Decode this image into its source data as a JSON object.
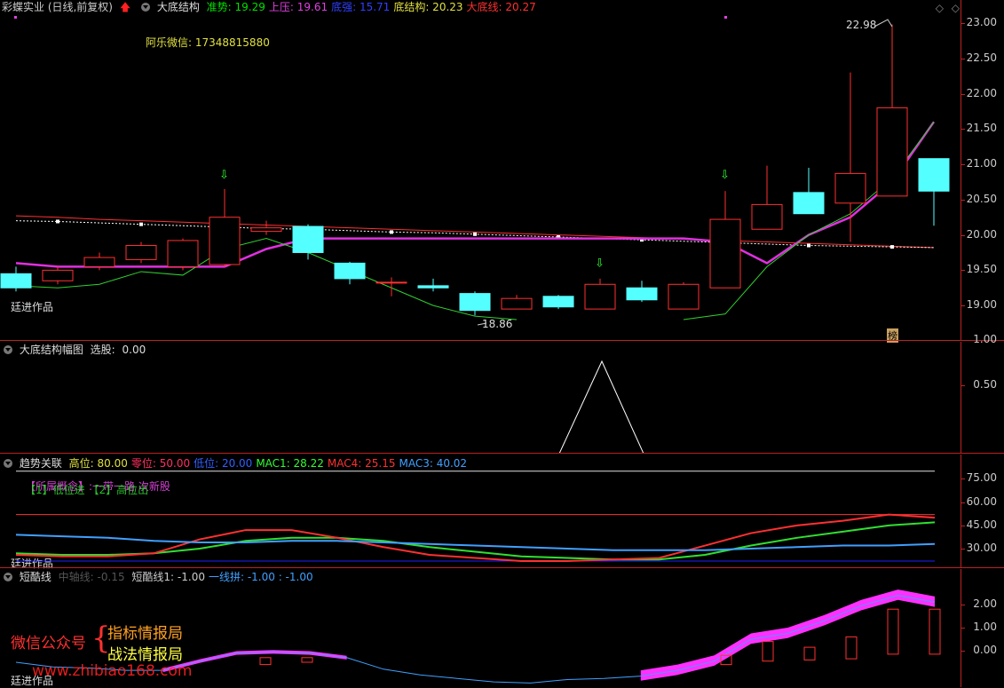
{
  "main": {
    "stock_name": "彩蝶实业 (日线,前复权)",
    "indicator": "大底结构",
    "values": [
      {
        "label": "准势:",
        "value": "19.29",
        "color": "#00e000"
      },
      {
        "label": "上压:",
        "value": "19.61",
        "color": "#e040e0"
      },
      {
        "label": "底强:",
        "value": "15.71",
        "color": "#3040ff"
      },
      {
        "label": "底结构:",
        "value": "20.23",
        "color": "#e0e040"
      },
      {
        "label": "大底线:",
        "value": "20.27",
        "color": "#ff3030"
      }
    ],
    "wechat_note": "阿乐微信: 17348815880",
    "author_tag": "廷进作品",
    "high_label": "22.98",
    "low_label": "18.86",
    "corner_badge": "榜",
    "axis_ticks": [
      "23.00",
      "22.50",
      "22.00",
      "21.50",
      "21.00",
      "20.50",
      "20.00",
      "19.50",
      "19.00"
    ]
  },
  "panel2": {
    "title": "大底结构幅图",
    "select_label": "选股:",
    "select_value": "0.00",
    "axis_ticks": [
      "1.00",
      "0.50"
    ]
  },
  "panel3": {
    "title": "趋势关联",
    "values": [
      {
        "label": "高位:",
        "value": "80.00",
        "color": "#e0e040"
      },
      {
        "label": "零位:",
        "value": "50.00",
        "color": "#ff3060"
      },
      {
        "label": "低位:",
        "value": "20.00",
        "color": "#3060ff"
      },
      {
        "label": "MAC1:",
        "value": "28.22",
        "color": "#30ff30"
      },
      {
        "label": "MAC4:",
        "value": "25.15",
        "color": "#ff3030"
      },
      {
        "label": "MAC3:",
        "value": "40.02",
        "color": "#40a0ff"
      }
    ],
    "concept_line": "【所属概念】:一带一路 次新股",
    "legend_line": "【1】低位进 【2】高位出",
    "author_tag": "廷进作品",
    "axis_ticks": [
      "75.00",
      "60.00",
      "45.00",
      "30.00"
    ]
  },
  "panel4": {
    "title": "短酷线",
    "faded": "中轴线: -0.15",
    "values": [
      {
        "label": "短酷线1:",
        "value": "-1.00",
        "color": "#cccccc"
      },
      {
        "label": "一线拼:",
        "value": "-1.00 : -1.00",
        "color": "#40a0ff"
      }
    ],
    "promo_left": "微信公众号",
    "promo_line1": "指标情报局",
    "promo_line2": "战法情报局",
    "site": "www.zhibiao168.com",
    "author_tag": "廷进作品",
    "axis_ticks": [
      "2.00",
      "1.00",
      "0.00"
    ]
  },
  "chart_data": [
    {
      "type": "candlestick",
      "title": "大底结构",
      "ylim": [
        18.7,
        23.1
      ],
      "candles": [
        {
          "o": 19.45,
          "c": 19.25,
          "h": 19.55,
          "l": 19.2
        },
        {
          "o": 19.35,
          "c": 19.5,
          "h": 19.55,
          "l": 19.3
        },
        {
          "o": 19.55,
          "c": 19.68,
          "h": 19.75,
          "l": 19.5
        },
        {
          "o": 19.65,
          "c": 19.85,
          "h": 19.9,
          "l": 19.6
        },
        {
          "o": 19.55,
          "c": 19.92,
          "h": 19.95,
          "l": 19.5
        },
        {
          "o": 19.58,
          "c": 20.25,
          "h": 20.65,
          "l": 19.55
        },
        {
          "o": 20.05,
          "c": 20.1,
          "h": 20.2,
          "l": 20.0
        },
        {
          "o": 20.12,
          "c": 19.75,
          "h": 20.15,
          "l": 19.65
        },
        {
          "o": 19.6,
          "c": 19.38,
          "h": 19.62,
          "l": 19.3
        },
        {
          "o": 19.33,
          "c": 19.33,
          "h": 19.4,
          "l": 19.13
        },
        {
          "o": 19.28,
          "c": 19.25,
          "h": 19.38,
          "l": 19.2
        },
        {
          "o": 19.17,
          "c": 18.93,
          "h": 19.2,
          "l": 18.86
        },
        {
          "o": 18.95,
          "c": 19.1,
          "h": 19.15,
          "l": 18.95
        },
        {
          "o": 19.13,
          "c": 18.98,
          "h": 19.15,
          "l": 18.95
        },
        {
          "o": 18.95,
          "c": 19.3,
          "h": 19.38,
          "l": 18.95
        },
        {
          "o": 19.25,
          "c": 19.08,
          "h": 19.35,
          "l": 19.05
        },
        {
          "o": 18.95,
          "c": 19.3,
          "h": 19.33,
          "l": 18.95
        },
        {
          "o": 19.25,
          "c": 20.22,
          "h": 20.62,
          "l": 19.25
        },
        {
          "o": 20.08,
          "c": 20.43,
          "h": 20.98,
          "l": 20.08
        },
        {
          "o": 20.6,
          "c": 20.3,
          "h": 20.95,
          "l": 20.3
        },
        {
          "o": 20.45,
          "c": 20.87,
          "h": 22.3,
          "l": 19.9
        },
        {
          "o": 20.55,
          "c": 21.8,
          "h": 22.98,
          "l": 20.55
        },
        {
          "o": 21.08,
          "c": 20.62,
          "h": 21.08,
          "l": 20.13
        }
      ],
      "series": [
        {
          "color": "#ff3030",
          "values": [
            20.27,
            20.25,
            20.22,
            20.2,
            20.18,
            20.16,
            20.14,
            20.12,
            20.1,
            20.08,
            20.06,
            20.04,
            20.02,
            20.0,
            19.98,
            19.96,
            19.94,
            19.92,
            19.9,
            19.88,
            19.86,
            19.84,
            19.82
          ]
        },
        {
          "color": "#ffffff",
          "values": [
            20.2,
            20.19,
            20.17,
            20.15,
            20.13,
            20.11,
            20.09,
            20.08,
            20.06,
            20.04,
            20.03,
            20.01,
            19.99,
            19.97,
            19.95,
            19.93,
            19.91,
            19.89,
            19.87,
            19.85,
            19.84,
            19.83,
            19.82
          ]
        },
        {
          "color": "#e030e0",
          "values": [
            19.6,
            19.55,
            19.55,
            19.55,
            19.55,
            19.55,
            19.8,
            19.95,
            19.95,
            19.95,
            19.95,
            19.95,
            19.95,
            19.95,
            19.95,
            19.95,
            19.95,
            19.9,
            19.6,
            20.0,
            20.25,
            20.75,
            21.6
          ]
        },
        {
          "color": "#30d030",
          "values": [
            19.28,
            19.25,
            19.3,
            19.48,
            19.43,
            19.8,
            19.95,
            19.75,
            19.5,
            19.25,
            19.0,
            18.85,
            18.8,
            null,
            18.8,
            null,
            18.8,
            18.88,
            19.55,
            20.0,
            20.3,
            20.8,
            21.6
          ]
        }
      ]
    },
    {
      "type": "line",
      "title": "大底结构幅图",
      "ylim": [
        0,
        1.2
      ],
      "values": [
        0,
        0,
        0,
        0,
        0,
        0,
        0,
        0,
        0,
        0,
        0,
        0,
        0,
        0,
        1,
        0,
        0,
        0,
        0,
        0,
        0,
        0,
        0
      ]
    },
    {
      "type": "line",
      "title": "趋势关联",
      "ylim": [
        20,
        85
      ],
      "series": [
        {
          "name": "MAC1",
          "color": "#30e030",
          "values": [
            27,
            26,
            26,
            27,
            30,
            35,
            37,
            37,
            35,
            31,
            28,
            25,
            24,
            23,
            23,
            26,
            32,
            37,
            41,
            45,
            47
          ]
        },
        {
          "name": "MAC4",
          "color": "#ff3030",
          "values": [
            26,
            25,
            25,
            27,
            36,
            42,
            42,
            37,
            31,
            26,
            24,
            22,
            22,
            23,
            24,
            32,
            40,
            45,
            48,
            52,
            50
          ]
        },
        {
          "name": "MAC3",
          "color": "#40a0ff",
          "values": [
            39,
            38,
            37,
            35,
            34,
            34,
            35,
            35,
            34,
            33,
            32,
            31,
            30,
            29,
            29,
            29,
            30,
            31,
            32,
            32,
            33
          ]
        },
        {
          "name": "高位",
          "color": "#e0e0e0",
          "values": [
            80,
            80
          ]
        },
        {
          "name": "零位",
          "color": "#ff3030",
          "values": [
            50,
            50
          ]
        },
        {
          "name": "低位",
          "color": "#2020ff",
          "values": [
            20,
            20
          ]
        }
      ]
    },
    {
      "type": "area",
      "title": "短酷线",
      "ylim": [
        -1.6,
        3.2
      ],
      "line": [
        -0.5,
        -0.7,
        -0.75,
        -0.85,
        -0.85,
        -0.45,
        -0.1,
        -0.05,
        -0.1,
        -0.3,
        -0.8,
        -1.05,
        -1.2,
        -1.35,
        -1.4,
        -1.25,
        -1.2,
        -1.1,
        -0.85,
        -0.45,
        0.5,
        0.75,
        1.3,
        1.95,
        2.4,
        2.1
      ]
    }
  ]
}
